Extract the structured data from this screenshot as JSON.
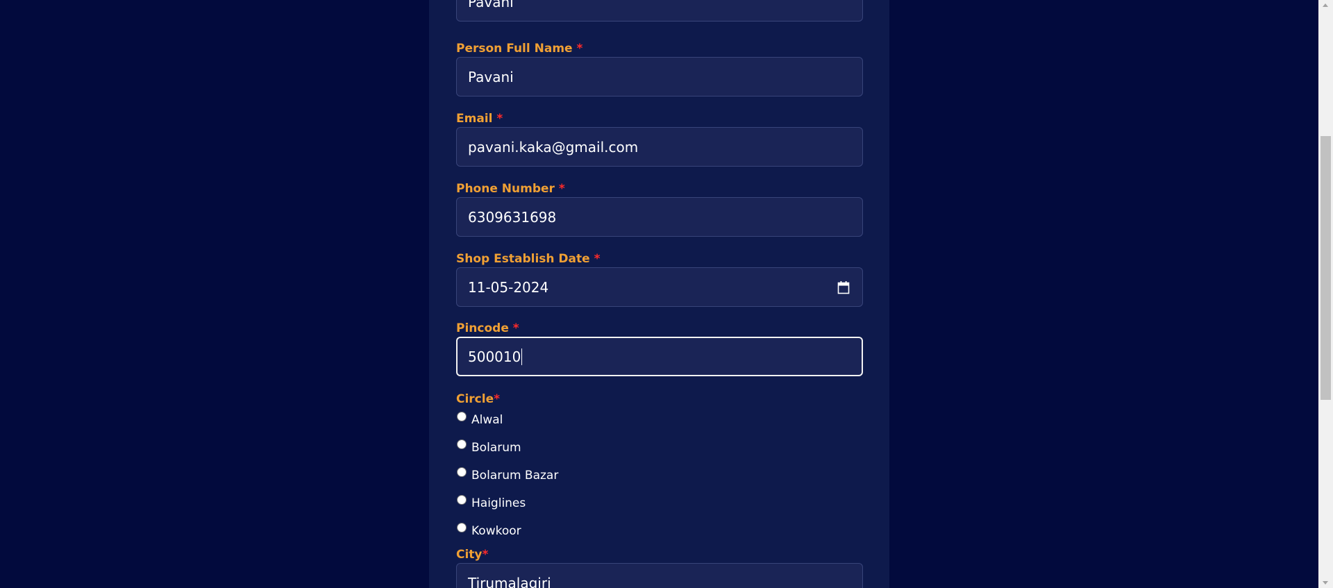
{
  "form": {
    "shop_name": {
      "value": "Pavani"
    },
    "person_full_name": {
      "label": "Person Full Name",
      "required_mark": "*",
      "value": "Pavani"
    },
    "email": {
      "label": "Email",
      "required_mark": "*",
      "value": "pavani.kaka@gmail.com"
    },
    "phone_number": {
      "label": "Phone Number",
      "required_mark": "*",
      "value": "6309631698"
    },
    "shop_establish_date": {
      "label": "Shop Establish Date",
      "required_mark": "*",
      "value": "11-05-2024",
      "icon": "calendar-icon"
    },
    "pincode": {
      "label": "Pincode",
      "required_mark": "*",
      "value": "500010"
    },
    "circle": {
      "label": "Circle",
      "required_mark": "*",
      "options": [
        "Alwal",
        "Bolarum",
        "Bolarum Bazar",
        "Haiglines",
        "Kowkoor"
      ],
      "selected": null
    },
    "city": {
      "label": "City",
      "required_mark": "*",
      "value": "Tirumalagiri"
    }
  },
  "colors": {
    "page_background": "#020a3d",
    "panel_background": "#0e1a4c",
    "input_background": "#1a2456",
    "label_color": "#f0a034",
    "required_color": "#ff2a2a",
    "text_color": "#ffffff"
  }
}
